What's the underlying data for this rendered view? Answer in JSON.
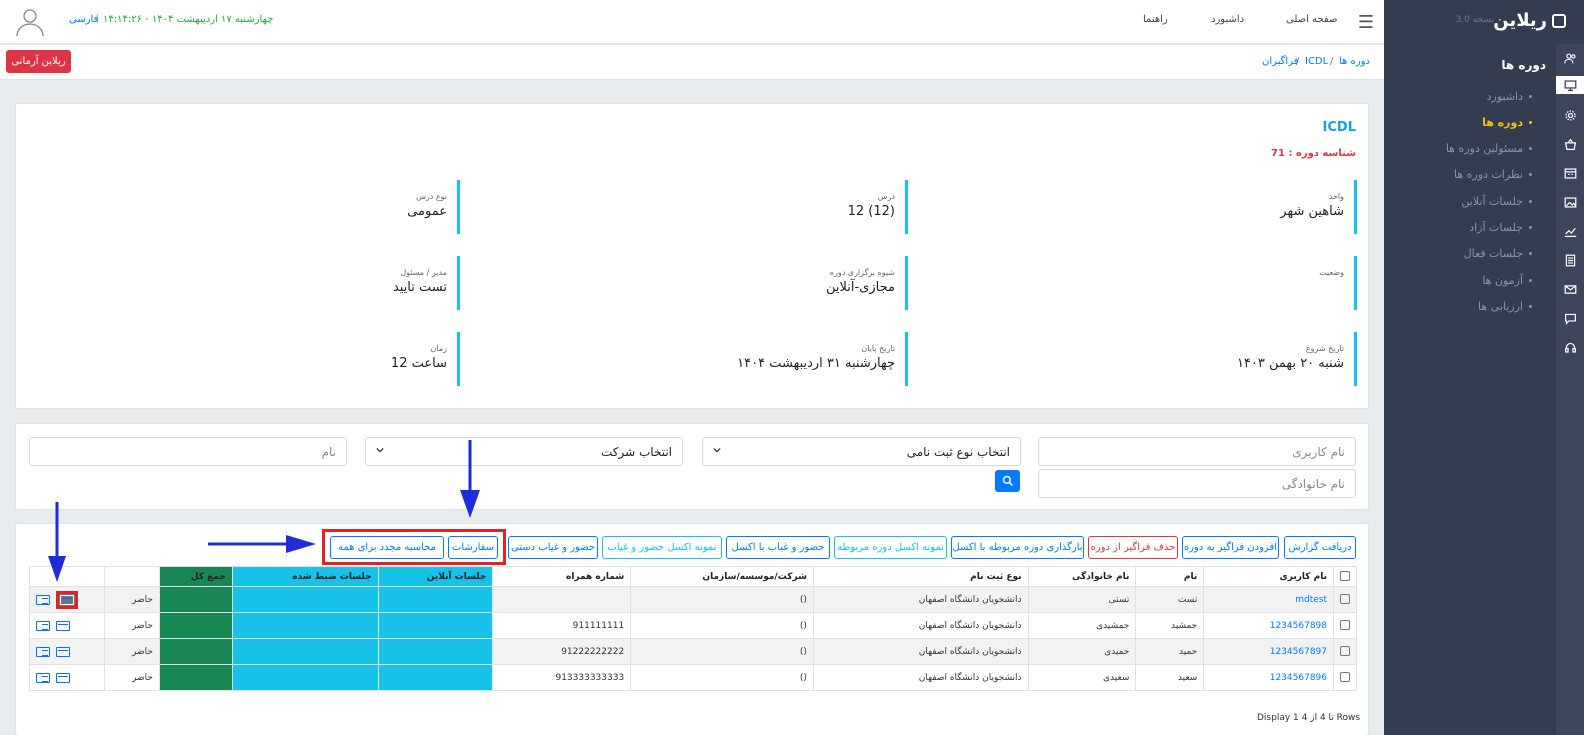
{
  "sidebar": {
    "logo": "ریلاین",
    "version": "نسخه 3.0",
    "title": "دوره ها",
    "items": [
      {
        "label": "داشبورد"
      },
      {
        "label": "دوره ها"
      },
      {
        "label": "مسئولین دوره ها"
      },
      {
        "label": "نظرات دوره ها"
      },
      {
        "label": "جلسات آنلاین"
      },
      {
        "label": "جلسات آزاد"
      },
      {
        "label": "جلسات فعال"
      },
      {
        "label": "آزمون ها"
      },
      {
        "label": "ارزیابی ها"
      }
    ],
    "icons": [
      "users-icon",
      "monitor-icon",
      "gear-icon",
      "basket-icon",
      "calendar-icon",
      "image-icon",
      "chart-icon",
      "document-icon",
      "mail-icon",
      "chat-icon",
      "headset-icon"
    ]
  },
  "topbar": {
    "nav": [
      "صفحه اصلی",
      "داشبورد",
      "راهنما"
    ],
    "datetime": "چهارشنبه ۱۷ اردیبهشت ۱۴۰۴ - ۱۴:۱۴:۲۶",
    "language": "فارسی"
  },
  "breadcrumb": [
    "دوره ها",
    "ICDL",
    "فراگیران"
  ],
  "tenant_button": "ریلاین آرمانی",
  "course": {
    "title": "ICDL",
    "id_label": "شناسه دوره : 71",
    "fields": [
      {
        "label": "واحد",
        "value": "شاهین شهر"
      },
      {
        "label": "درس",
        "value": "12 (12)"
      },
      {
        "label": "نوع درس",
        "value": "عمومی"
      },
      {
        "label": "وضعیت",
        "value": ""
      },
      {
        "label": "شیوه برگزاری دوره",
        "value": "مجازی-آنلاین"
      },
      {
        "label": "مدیر / مسئول",
        "value": "تست تایید"
      },
      {
        "label": "تاریخ شروع",
        "value": "شنبه ۲۰ بهمن ۱۴۰۳"
      },
      {
        "label": "تاریخ پایان",
        "value": "چهارشنبه ۳۱ اردیبهشت ۱۴۰۴"
      },
      {
        "label": "زمان",
        "value": "12 ساعت"
      }
    ]
  },
  "filters": {
    "username_placeholder": "نام کاربری",
    "lastname_placeholder": "نام خانوادگی",
    "name_placeholder": "نام",
    "registration_select": "انتخاب نوع ثبت نامی",
    "company_select": "انتخاب شرکت"
  },
  "actions": {
    "get_report": "دریافت گزارش",
    "add_learner": "افزودن فراگیر به دوره",
    "remove_learner": "حذف فراگیر از دوره",
    "upload_excel": "بارگذاری دوره مربوطه با اکسل",
    "sample_excel": "نمونه اکسل دوره مربوطه",
    "attendance_excel": "حضور و غیاب با اکسل",
    "sample_attendance": "نمونه اکسل حضور و غیاب",
    "manual_attendance": "حضور و غیاب دستی",
    "orders": "سفارشات",
    "recalculate": "محاسبه مجدد برای همه"
  },
  "table": {
    "headers": [
      "نام کاربری",
      "نام",
      "نام خانوادگی",
      "نوع ثبت نام",
      "شرکت/موسسه/سازمان",
      "شماره همراه",
      "جلسات آنلاین",
      "جلسات ضبط شده",
      "جمع کل",
      "",
      ""
    ],
    "rows": [
      [
        "mdtest",
        "تست",
        "تستی",
        "دانشجویان دانشگاه اصفهان",
        "()",
        "",
        "",
        "",
        "",
        "حاضر"
      ],
      [
        "1234567898",
        "جمشید",
        "جمشیدی",
        "دانشجویان دانشگاه اصفهان",
        "()",
        "911111111",
        "",
        "",
        "",
        "حاضر"
      ],
      [
        "1234567897",
        "حمید",
        "حمیدی",
        "دانشجویان دانشگاه اصفهان",
        "()",
        "91222222222",
        "",
        "",
        "",
        "حاضر"
      ],
      [
        "1234567896",
        "سعید",
        "سعیدی",
        "دانشجویان دانشگاه اصفهان",
        "()",
        "913333333333",
        "",
        "",
        "",
        "حاضر"
      ]
    ]
  },
  "footer": {
    "display": "Display 1 تا 4 از 4 Rows"
  },
  "colors": {
    "sidebar": "#343c4f",
    "accent": "#17c1e8",
    "green": "#198754",
    "danger": "#dc3545",
    "primary": "#007bff"
  }
}
